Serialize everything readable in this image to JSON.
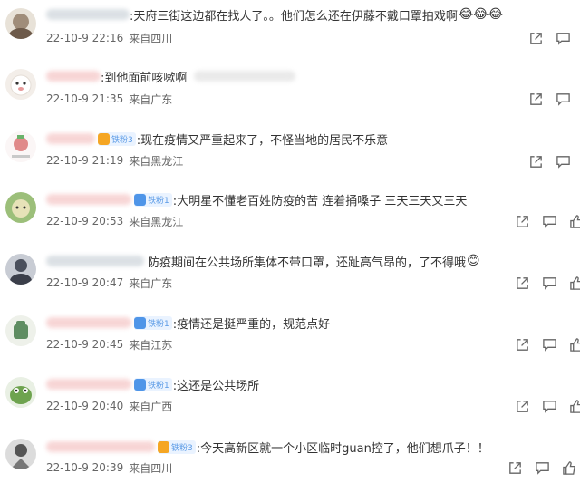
{
  "comments": [
    {
      "text": ":天府三街这边都在找人了。。他们怎么还在伊藤不戴口罩拍戏啊",
      "emoji": "😂😂😂",
      "badge": "",
      "date": "22-10-9 22:16",
      "location": "来自四川"
    },
    {
      "text": ":到他面前咳嗽啊",
      "emoji": "",
      "badge": "",
      "date": "22-10-9 21:35",
      "location": "来自广东"
    },
    {
      "text": ":现在疫情又严重起来了，不怪当地的居民不乐意",
      "emoji": "",
      "badge": "铁粉3",
      "date": "22-10-9 21:19",
      "location": "来自黑龙江"
    },
    {
      "text": ":大明星不懂老百姓防疫的苦 连着捅嗓子 三天三天又三天",
      "emoji": "",
      "badge": "铁粉1",
      "date": "22-10-9 20:53",
      "location": "来自黑龙江"
    },
    {
      "text": "防疫期间在公共场所集体不带口罩，还趾高气昂的，了不得哦",
      "emoji": "😊",
      "badge": "",
      "date": "22-10-9 20:47",
      "location": "来自广东"
    },
    {
      "text": ":疫情还是挺严重的，规范点好",
      "emoji": "",
      "badge": "铁粉1",
      "date": "22-10-9 20:45",
      "location": "来自江苏"
    },
    {
      "text": ":这还是公共场所",
      "emoji": "",
      "badge": "铁粉1",
      "date": "22-10-9 20:40",
      "location": "来自广西"
    },
    {
      "text": ":今天高新区就一个小区临时guan控了，他们想爪子！！",
      "emoji": "",
      "badge": "铁粉3",
      "date": "22-10-9 20:39",
      "location": "来自四川"
    }
  ],
  "icons": [
    "share-icon",
    "comment-icon",
    "like-icon"
  ],
  "colors": {
    "text": "#333333",
    "meta": "#666666",
    "badge_text": "#5a9ae6",
    "badge_bg": "#eaf3ff"
  }
}
